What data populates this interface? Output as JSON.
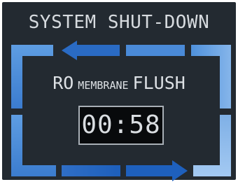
{
  "screen": {
    "title": "SYSTEM SHUT-DOWN",
    "process": {
      "word1": "RO",
      "word2": "MEMBRANE",
      "word3": "FLUSH"
    },
    "countdown": "00:58"
  },
  "frame": {
    "flow_direction": "clockwise",
    "top_arrow_icon": "arrow-left-icon",
    "bottom_arrow_icon": "arrow-right-icon"
  },
  "colors": {
    "background": "#232a31",
    "text": "#d7dbdf",
    "blue_light": "#7fb0e6",
    "blue_mid": "#4d8fd8",
    "blue_dark": "#1f63bd",
    "timer_bg": "#080a0c",
    "timer_border": "#a8afb6"
  }
}
